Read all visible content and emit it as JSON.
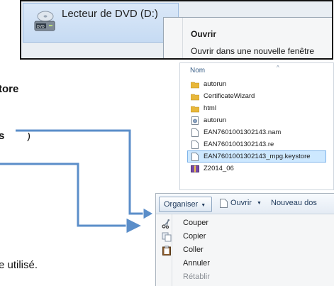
{
  "drive": {
    "label": "Lecteur de DVD (D:)"
  },
  "context_menu": {
    "open": "Ouvrir",
    "open_new_window": "Ouvrir dans une nouvelle fenêtre"
  },
  "left_text": {
    "fragment_tore": "tore",
    "fragment_s": "s",
    "fragment_paren": ")",
    "fragment_used": "e utilisé."
  },
  "file_list": {
    "column_name": "Nom",
    "items": [
      {
        "name": "autorun",
        "icon": "folder-icon"
      },
      {
        "name": "CertificateWizard",
        "icon": "folder-icon"
      },
      {
        "name": "html",
        "icon": "folder-icon"
      },
      {
        "name": "autorun",
        "icon": "settings-file-icon"
      },
      {
        "name": "EAN7601001302143.nam",
        "icon": "file-icon"
      },
      {
        "name": "EAN7601001302143.re",
        "icon": "file-icon"
      },
      {
        "name": "EAN7601001302143_mpg.keystore",
        "icon": "file-icon",
        "selected": true
      },
      {
        "name": "Z2014_06",
        "icon": "archive-icon"
      }
    ]
  },
  "toolbar": {
    "organize": "Organiser",
    "open": "Ouvrir",
    "new_folder": "Nouveau dos"
  },
  "edit_menu": {
    "cut": "Couper",
    "copy": "Copier",
    "paste": "Coller",
    "undo": "Annuler",
    "redo": "Rétablir"
  },
  "colors": {
    "arrow": "#5b8ec9",
    "selection": "#cde8ff",
    "folder": "#e8b73a"
  }
}
